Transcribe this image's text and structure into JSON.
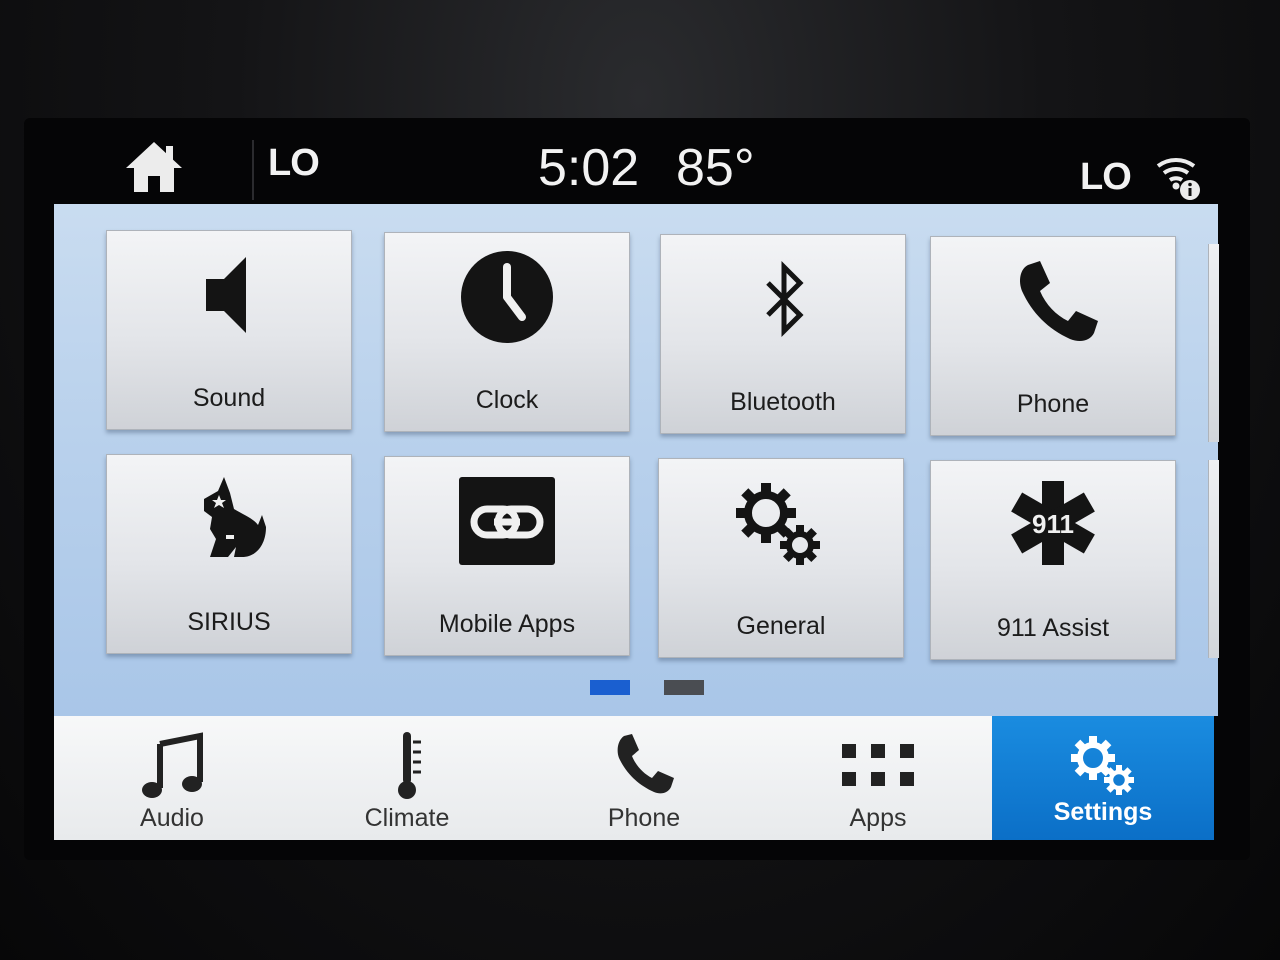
{
  "status_bar": {
    "left_value": "LO",
    "time": "5:02",
    "temperature": "85°",
    "right_value": "LO"
  },
  "tiles": [
    {
      "label": "Sound",
      "icon": "speaker-icon"
    },
    {
      "label": "Clock",
      "icon": "clock-icon"
    },
    {
      "label": "Bluetooth",
      "icon": "bluetooth-icon"
    },
    {
      "label": "Phone",
      "icon": "phone-icon"
    },
    {
      "label": "SIRIUS",
      "icon": "sirius-dog-icon"
    },
    {
      "label": "Mobile Apps",
      "icon": "link-icon"
    },
    {
      "label": "General",
      "icon": "gears-icon"
    },
    {
      "label": "911 Assist",
      "icon": "star-of-life-911-icon"
    }
  ],
  "pagination": {
    "pages": 2,
    "current": 1
  },
  "nav": [
    {
      "label": "Audio",
      "icon": "music-note-icon"
    },
    {
      "label": "Climate",
      "icon": "thermometer-icon"
    },
    {
      "label": "Phone",
      "icon": "phone-icon"
    },
    {
      "label": "Apps",
      "icon": "grid-icon"
    },
    {
      "label": "Settings",
      "icon": "gears-icon",
      "active": true
    }
  ],
  "colors": {
    "accent": "#0b6fc7",
    "page_dot_active": "#1a5fd0",
    "page_dot_inactive": "#4a4d52"
  }
}
